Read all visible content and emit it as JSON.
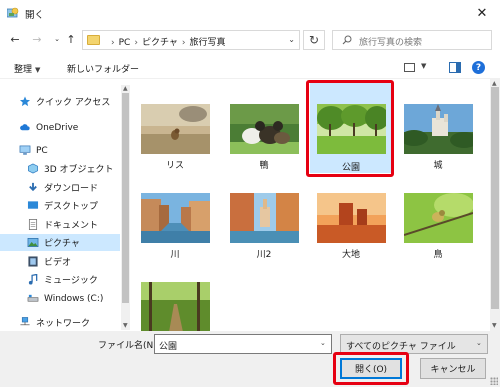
{
  "window": {
    "title": "開く"
  },
  "address": {
    "crumbs": [
      "PC",
      "ピクチャ",
      "旅行写真"
    ]
  },
  "search": {
    "placeholder": "旅行写真の検索"
  },
  "commands": {
    "organize": "整理",
    "new_folder": "新しいフォルダー"
  },
  "sidebar": {
    "items": [
      {
        "label": "クイック アクセス",
        "icon": "star-icon"
      },
      {
        "label": "OneDrive",
        "icon": "cloud-icon"
      },
      {
        "label": "PC",
        "icon": "computer-icon"
      },
      {
        "label": "3D オブジェクト",
        "icon": "cube-icon"
      },
      {
        "label": "ダウンロード",
        "icon": "download-icon"
      },
      {
        "label": "デスクトップ",
        "icon": "desktop-icon"
      },
      {
        "label": "ドキュメント",
        "icon": "document-icon"
      },
      {
        "label": "ピクチャ",
        "icon": "pictures-icon",
        "selected": true
      },
      {
        "label": "ビデオ",
        "icon": "video-icon"
      },
      {
        "label": "ミュージック",
        "icon": "music-icon"
      },
      {
        "label": "Windows (C:)",
        "icon": "drive-icon"
      },
      {
        "label": "ネットワーク",
        "icon": "network-icon"
      }
    ]
  },
  "files": [
    {
      "name": "リス"
    },
    {
      "name": "鴨"
    },
    {
      "name": "公園",
      "selected": true
    },
    {
      "name": "城"
    },
    {
      "name": "川"
    },
    {
      "name": "川2"
    },
    {
      "name": "大地"
    },
    {
      "name": "鳥"
    },
    {
      "name": ""
    }
  ],
  "footer": {
    "filename_label": "ファイル名(N):",
    "filename_value": "公園",
    "filetype_value": "すべてのピクチャ ファイル",
    "open_label": "開く(O)",
    "cancel_label": "キャンセル"
  },
  "colors": {
    "selection": "#cce8ff",
    "highlight": "#e60012",
    "accent": "#0078d7"
  }
}
